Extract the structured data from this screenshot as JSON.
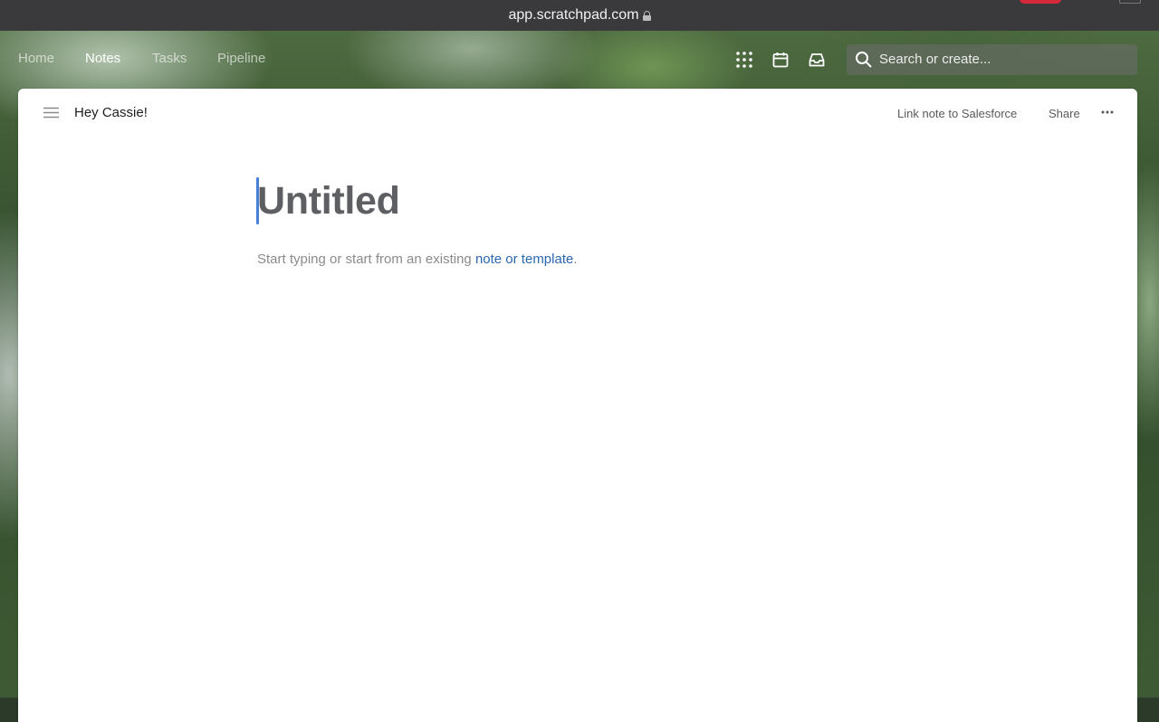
{
  "browser": {
    "url": "app.scratchpad.com"
  },
  "nav": {
    "links": [
      "Home",
      "Notes",
      "Tasks",
      "Pipeline"
    ],
    "active": "Notes"
  },
  "search": {
    "placeholder": "Search or create..."
  },
  "card": {
    "greeting": "Hey Cassie!",
    "link_salesforce": "Link note to Salesforce",
    "share": "Share"
  },
  "editor": {
    "title_placeholder": "Untitled",
    "hint_prefix": "Start typing or start from an existing ",
    "hint_link": "note or template",
    "hint_suffix": "."
  },
  "icons": {
    "nav": [
      "apps-grid-icon",
      "calendar-icon",
      "inbox-icon"
    ],
    "search": "search-icon",
    "menu": "hamburger-menu-icon",
    "more": "more-options-icon",
    "lock": "lock-icon"
  },
  "colors": {
    "link": "#2a67b1",
    "caret": "#4a7fd6",
    "browser_badge": "#d6283a"
  }
}
